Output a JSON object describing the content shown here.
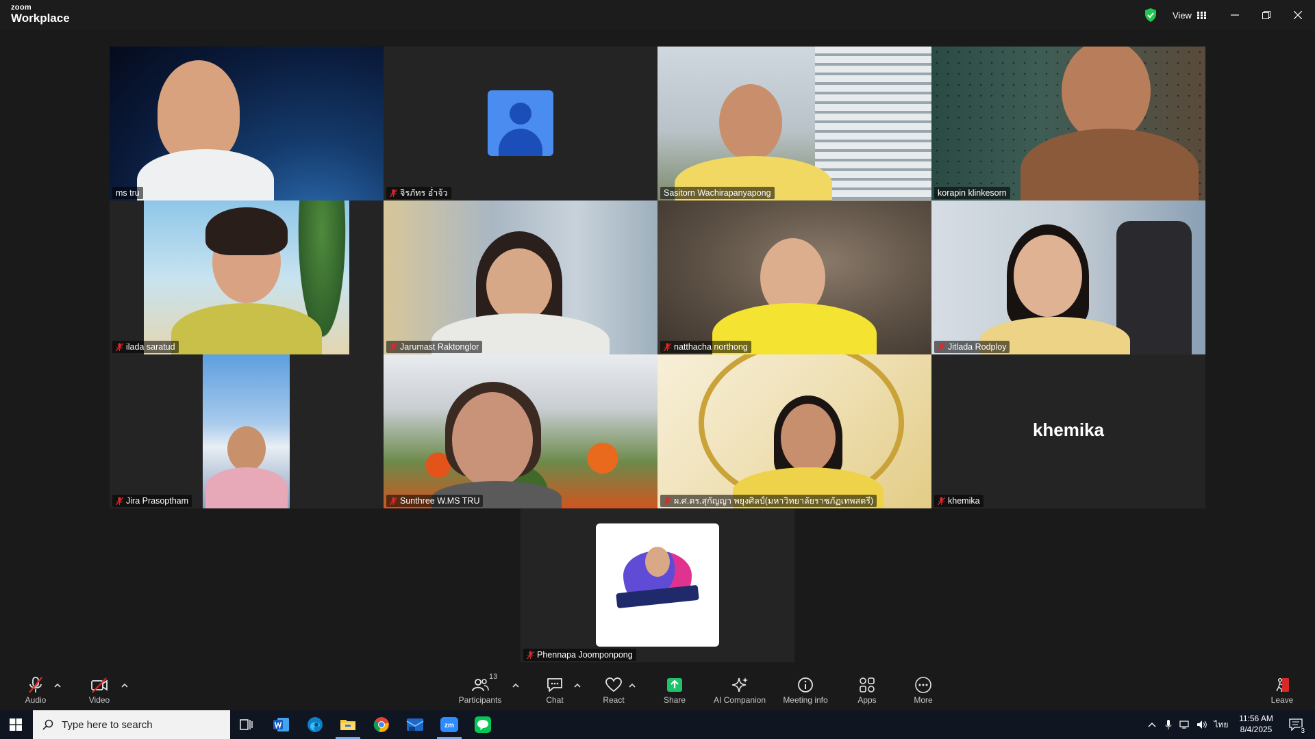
{
  "titlebar": {
    "brand_small": "zoom",
    "brand_large": "Workplace",
    "view_label": "View"
  },
  "participants": [
    {
      "name": "ms tru",
      "muted": false
    },
    {
      "name": "จิรภัทร อ่ำจ้ว",
      "muted": true
    },
    {
      "name": "Sasitorn Wachirapanyapong",
      "muted": false
    },
    {
      "name": "korapin klinkesorn",
      "muted": false,
      "active_speaker": true
    },
    {
      "name": "ilada saratud",
      "muted": true
    },
    {
      "name": "Jarumast Raktonglor",
      "muted": true
    },
    {
      "name": "natthacha northong",
      "muted": true
    },
    {
      "name": "Jitlada Rodploy",
      "muted": true
    },
    {
      "name": "Jira Prasoptham",
      "muted": true
    },
    {
      "name": "Sunthree W.MS TRU",
      "muted": true
    },
    {
      "name": "ผ.ศ.ดร.สุกัญญา พยุงศิลป์(มหาวิทยาลัยราชภัฏเทพสตรี)",
      "muted": true
    },
    {
      "name": "khemika",
      "muted": true,
      "video_off_label": "khemika"
    },
    {
      "name": "Phennapa Joomponpong",
      "muted": true
    }
  ],
  "toolbar": {
    "audio": "Audio",
    "video": "Video",
    "participants": "Participants",
    "participants_count": "13",
    "chat": "Chat",
    "react": "React",
    "share": "Share",
    "ai_companion": "AI Companion",
    "meeting_info": "Meeting info",
    "apps": "Apps",
    "more": "More",
    "leave": "Leave"
  },
  "taskbar": {
    "search_placeholder": "Type here to search",
    "language": "ไทย",
    "time": "11:56 AM",
    "date": "8/4/2025",
    "notifications": "3"
  },
  "colors": {
    "active_speaker": "#23d9a1",
    "share_green": "#1ec26b",
    "mute_red": "#e02828"
  }
}
